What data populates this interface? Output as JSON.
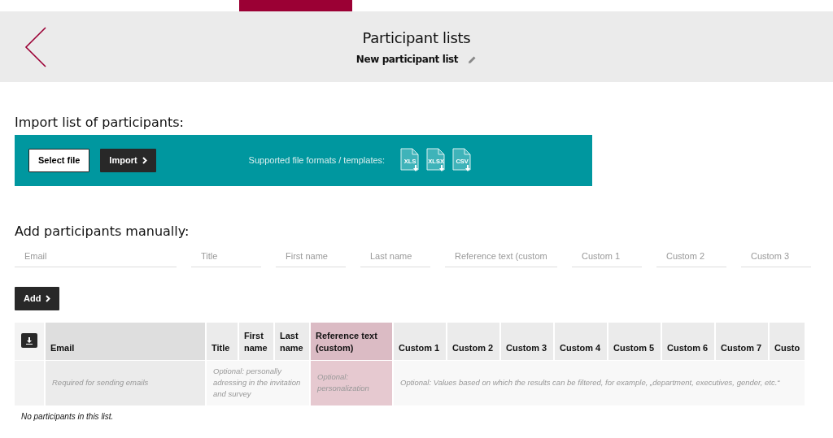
{
  "header": {
    "title": "Participant lists",
    "subtitle": "New participant list"
  },
  "import": {
    "heading": "Import list of participants:",
    "select_button": "Select file",
    "import_button": "Import",
    "formats_label": "Supported file formats / templates:",
    "formats": [
      "XLS",
      "XLSX",
      "CSV"
    ]
  },
  "manual": {
    "heading": "Add participants manually:",
    "fields": [
      {
        "placeholder": "Email"
      },
      {
        "placeholder": "Title"
      },
      {
        "placeholder": "First name"
      },
      {
        "placeholder": "Last name"
      },
      {
        "placeholder": "Reference text (custom"
      },
      {
        "placeholder": "Custom 1"
      },
      {
        "placeholder": "Custom 2"
      },
      {
        "placeholder": "Custom 3"
      }
    ],
    "add_button": "Add"
  },
  "table": {
    "columns": [
      {
        "kind": "download"
      },
      {
        "label": "Email",
        "kind": "required"
      },
      {
        "label": "Title",
        "kind": "optional"
      },
      {
        "label": "First name",
        "kind": "optional"
      },
      {
        "label": "Last name",
        "kind": "optional"
      },
      {
        "label": "Reference text (custom)",
        "kind": "reference"
      },
      {
        "label": "Custom 1",
        "kind": "custom"
      },
      {
        "label": "Custom 2",
        "kind": "custom"
      },
      {
        "label": "Custom 3",
        "kind": "custom"
      },
      {
        "label": "Custom 4",
        "kind": "custom"
      },
      {
        "label": "Custom 5",
        "kind": "custom"
      },
      {
        "label": "Custom 6",
        "kind": "custom"
      },
      {
        "label": "Custom 7",
        "kind": "custom"
      },
      {
        "label": "Custo",
        "kind": "custom"
      }
    ],
    "hints": [
      {
        "kind": "download"
      },
      {
        "kind": "required",
        "text": "Required for sending emails"
      },
      {
        "kind": "optional",
        "text": "Optional: personally adressing in the invitation and survey"
      },
      {
        "kind": "reference",
        "text": "Optional: personalization"
      },
      {
        "kind": "custom",
        "text": "Optional: Values based on which the results can be filtered, for example, „department, executives, gender, etc.“"
      }
    ],
    "empty_message": "No participants in this list."
  }
}
